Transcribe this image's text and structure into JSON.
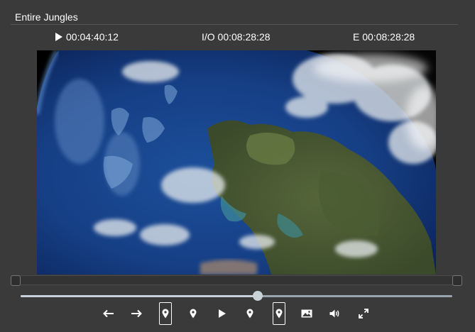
{
  "player": {
    "title": "Entire Jungles",
    "timecodes": {
      "current": "00:04:40:12",
      "io": "I/O 00:08:28:28",
      "end": "E 00:08:28:28"
    },
    "seek_progress": 0.55,
    "colors": {
      "background": "#3a3a3a",
      "text": "#ffffff",
      "seek_track": "#9aa4ad",
      "seek_thumb": "#c8d2d9"
    },
    "controls": [
      {
        "name": "step-back-button",
        "icon": "arrow-left-icon"
      },
      {
        "name": "step-forward-button",
        "icon": "arrow-right-icon"
      },
      {
        "name": "mark-in-button",
        "icon": "map-pin-icon",
        "boxed": true
      },
      {
        "name": "go-to-in-button",
        "icon": "map-pin-icon"
      },
      {
        "name": "play-button",
        "icon": "play-icon"
      },
      {
        "name": "go-to-out-button",
        "icon": "map-pin-icon"
      },
      {
        "name": "mark-out-button",
        "icon": "map-pin-icon",
        "boxed": true
      },
      {
        "name": "snapshot-button",
        "icon": "image-icon"
      },
      {
        "name": "volume-button",
        "icon": "volume-icon"
      },
      {
        "name": "fullscreen-button",
        "icon": "expand-icon"
      }
    ]
  }
}
